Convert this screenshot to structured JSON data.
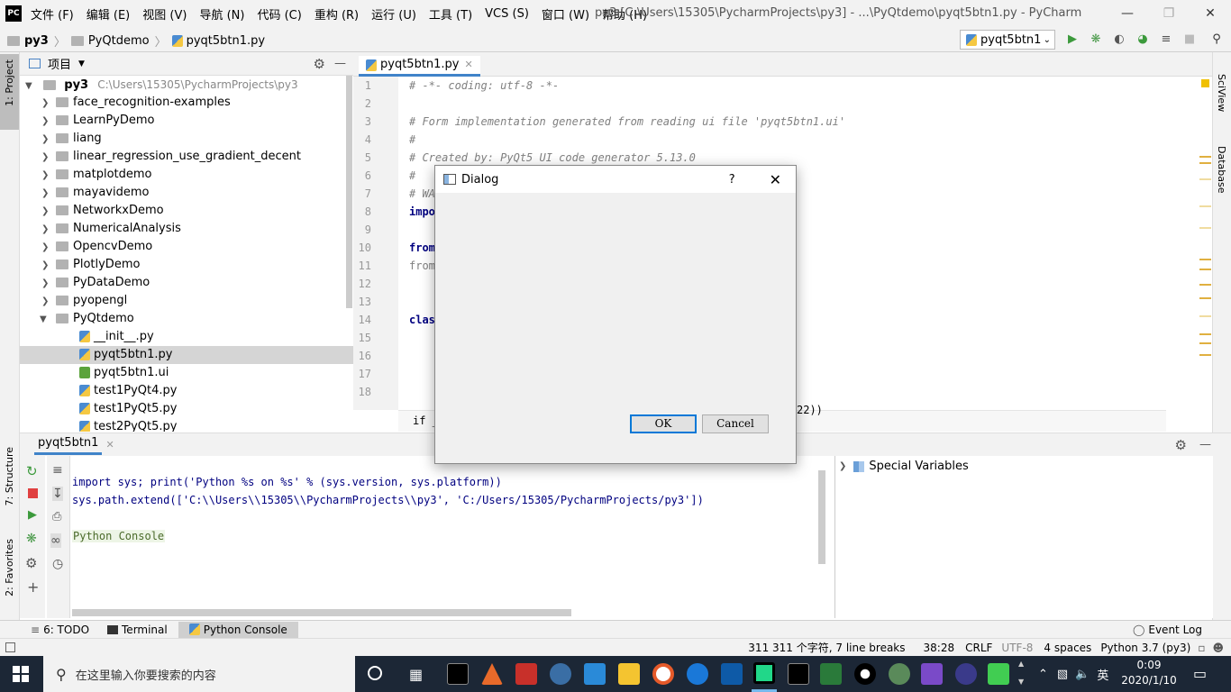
{
  "app": {
    "logo": "PC",
    "menus": [
      "文件 (F)",
      "编辑 (E)",
      "视图 (V)",
      "导航 (N)",
      "代码 (C)",
      "重构 (R)",
      "运行 (U)",
      "工具 (T)",
      "VCS (S)",
      "窗口 (W)",
      "帮助 (H)"
    ],
    "window_title": "py3 [C:\\Users\\15305\\PycharmProjects\\py3] - ...\\PyQtdemo\\pyqt5btn1.py - PyCharm"
  },
  "navbar": {
    "crumbs": [
      "py3",
      "PyQtdemo",
      "pyqt5btn1.py"
    ],
    "run_config": "pyqt5btn1"
  },
  "left_strip": {
    "project": "1: Project",
    "structure": "7: Structure",
    "favorites": "2: Favorites"
  },
  "right_strip": {
    "sciview": "SciView",
    "database": "Database"
  },
  "project": {
    "header": "项目",
    "root": {
      "name": "py3",
      "path": "C:\\Users\\15305\\PycharmProjects\\py3"
    },
    "folders": [
      "face_recognition-examples",
      "LearnPyDemo",
      "liang",
      "linear_regression_use_gradient_decent",
      "matplotdemo",
      "mayavidemo",
      "NetworkxDemo",
      "NumericalAnalysis",
      "OpencvDemo",
      "PlotlyDemo",
      "PyDataDemo",
      "pyopengl",
      "PyQtdemo"
    ],
    "files": [
      "__init__.py",
      "pyqt5btn1.py",
      "pyqt5btn1.ui",
      "test1PyQt4.py",
      "test1PyQt5.py",
      "test2PyQt5.py"
    ]
  },
  "editor": {
    "tab": "pyqt5btn1.py",
    "line_numbers": [
      "1",
      "2",
      "3",
      "4",
      "5",
      "6",
      "7",
      "8",
      "9",
      "10",
      "11",
      "12",
      "13",
      "14",
      "15",
      "16",
      "17",
      "18"
    ],
    "lines": {
      "l1": "# -*- coding: utf-8 -*-",
      "l3": "# Form implementation generated from reading ui file 'pyqt5btn1.ui'",
      "l4": "#",
      "l5": "# Created by: PyQt5 UI code generator 5.13.0",
      "l6": "#",
      "l7": "# WA",
      "l8": "impo",
      "l10": "from",
      "l11": "from",
      "l14": "clas",
      "l19": "if _n",
      "l19b": "22))"
    }
  },
  "bottom": {
    "tab": "pyqt5btn1",
    "console_lines": [
      "import sys; print('Python %s on %s' % (sys.version, sys.platform))",
      "sys.path.extend(['C:\\\\Users\\\\15305\\\\PycharmProjects\\\\py3', 'C:/Users/15305/PycharmProjects/py3'])"
    ],
    "console_label": "Python Console",
    "special_vars": "Special Variables"
  },
  "toolwindows": {
    "todo": "6: TODO",
    "terminal": "Terminal",
    "python_console": "Python Console",
    "event_log": "Event Log"
  },
  "status": {
    "chars": "311 311 个字符, 7 line breaks",
    "pos": "38:28",
    "eol": "CRLF",
    "enc": "UTF-8",
    "indent": "4 spaces",
    "interp": "Python 3.7 (py3)"
  },
  "taskbar": {
    "search_placeholder": "在这里输入你要搜索的内容",
    "ime": "英",
    "time": "0:09",
    "date": "2020/1/10"
  },
  "dialog": {
    "title": "Dialog",
    "help": "?",
    "ok": "OK",
    "cancel": "Cancel"
  }
}
